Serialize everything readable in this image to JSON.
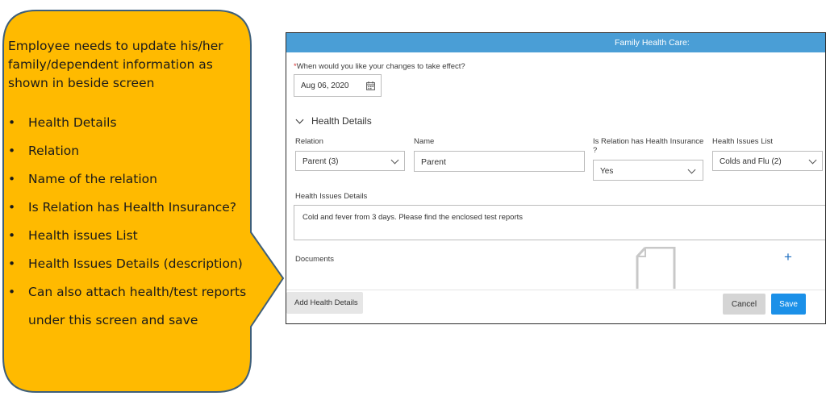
{
  "callout": {
    "intro": "Employee needs to update his/her family/dependent information as shown in beside screen",
    "bullets": [
      "Health Details",
      "Relation",
      "Name of the relation",
      "Is Relation has Health Insurance?",
      "Health issues List",
      "Health Issues Details (description)",
      "Can also attach health/test reports"
    ],
    "continuation": "under this screen and save",
    "bullet_glyph": "•",
    "fill_color": "#FFBA00",
    "border_color": "#3E5F7A"
  },
  "screen": {
    "title": "Family Health Care:",
    "title_bar_color": "#4A9ED6",
    "effective_date": {
      "required_mark": "*",
      "label": "When would you like your changes to take effect?",
      "value": "Aug 06, 2020",
      "icon": "calendar-icon"
    },
    "section": {
      "title": "Health Details",
      "toggle_icon": "chevron-down-icon"
    },
    "fields": {
      "relation": {
        "label": "Relation",
        "value": "Parent (3)"
      },
      "name": {
        "label": "Name",
        "value": "Parent"
      },
      "insurance": {
        "label_line1": "Is Relation has Health Insurance",
        "label_line2": "?",
        "value": "Yes"
      },
      "issues_list": {
        "label": "Health Issues List",
        "value": "Colds and Flu (2)"
      },
      "issues_details": {
        "label": "Health Issues Details",
        "value": "Cold and fever from 3 days. Please find the enclosed test reports"
      }
    },
    "documents": {
      "label": "Documents",
      "add_icon_glyph": "+",
      "file_icon": "document-icon"
    },
    "footer": {
      "add_button": "Add Health Details",
      "cancel_button": "Cancel",
      "save_button": "Save",
      "save_color": "#1B90E8"
    }
  }
}
